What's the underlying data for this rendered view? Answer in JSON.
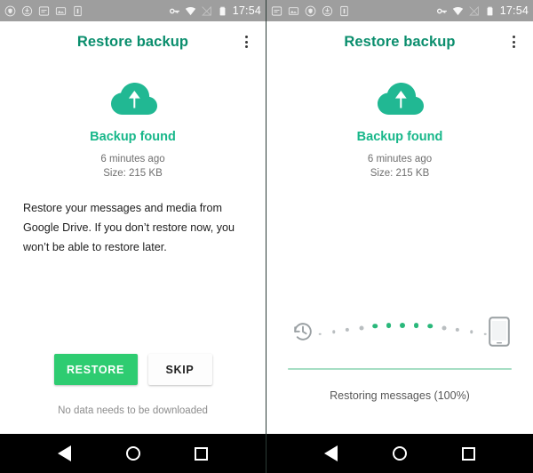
{
  "panels": [
    {
      "id": "restore-prompt",
      "statusbar": {
        "left_icons": [
          "shield-icon",
          "download-icon",
          "chat-icon",
          "image-icon",
          "sim-card-icon"
        ],
        "right_icons": [
          "vpn-key-icon",
          "wifi-icon",
          "signal-off-icon",
          "battery-icon"
        ],
        "time": "17:54"
      },
      "appbar": {
        "title": "Restore backup",
        "overflow": "overflow-menu"
      },
      "hero": {
        "icon": "cloud-upload-icon",
        "title": "Backup found",
        "time_ago": "6 minutes ago",
        "size": "Size: 215 KB"
      },
      "description": "Restore your messages and media from Google Drive. If you don’t restore now, you won’t be able to restore later.",
      "buttons": {
        "primary": "RESTORE",
        "secondary": "SKIP"
      },
      "footnote": "No data needs to be downloaded",
      "navbar": [
        "back-button",
        "home-button",
        "recents-button"
      ]
    },
    {
      "id": "restore-progress",
      "statusbar": {
        "left_icons": [
          "chat-icon",
          "image-icon",
          "shield-icon",
          "download-icon",
          "sim-card-icon"
        ],
        "right_icons": [
          "vpn-key-icon",
          "wifi-icon",
          "signal-off-icon",
          "battery-icon"
        ],
        "time": "17:54"
      },
      "appbar": {
        "title": "Restore backup",
        "overflow": "overflow-menu"
      },
      "hero": {
        "icon": "cloud-upload-icon",
        "title": "Backup found",
        "time_ago": "6 minutes ago",
        "size": "Size: 215 KB"
      },
      "progress": {
        "source_icon": "restore-history-icon",
        "target_icon": "phone-icon",
        "percent": 100,
        "label": "Restoring messages (100%)"
      },
      "navbar": [
        "back-button",
        "home-button",
        "recents-button"
      ]
    }
  ],
  "colors": {
    "accent_title": "#0a8e6d",
    "accent_hero": "#18b78a",
    "restore_button": "#2ecc71",
    "progress_fill": "#a6dec4",
    "statusbar_bg": "#9e9e9e",
    "navbar_bg": "#000000",
    "dot_active": "#2ab87b",
    "dot_inactive": "#b9bec0"
  },
  "transfer_dots": {
    "count": 13,
    "active_indices": [
      4,
      5,
      6,
      7,
      8
    ]
  }
}
